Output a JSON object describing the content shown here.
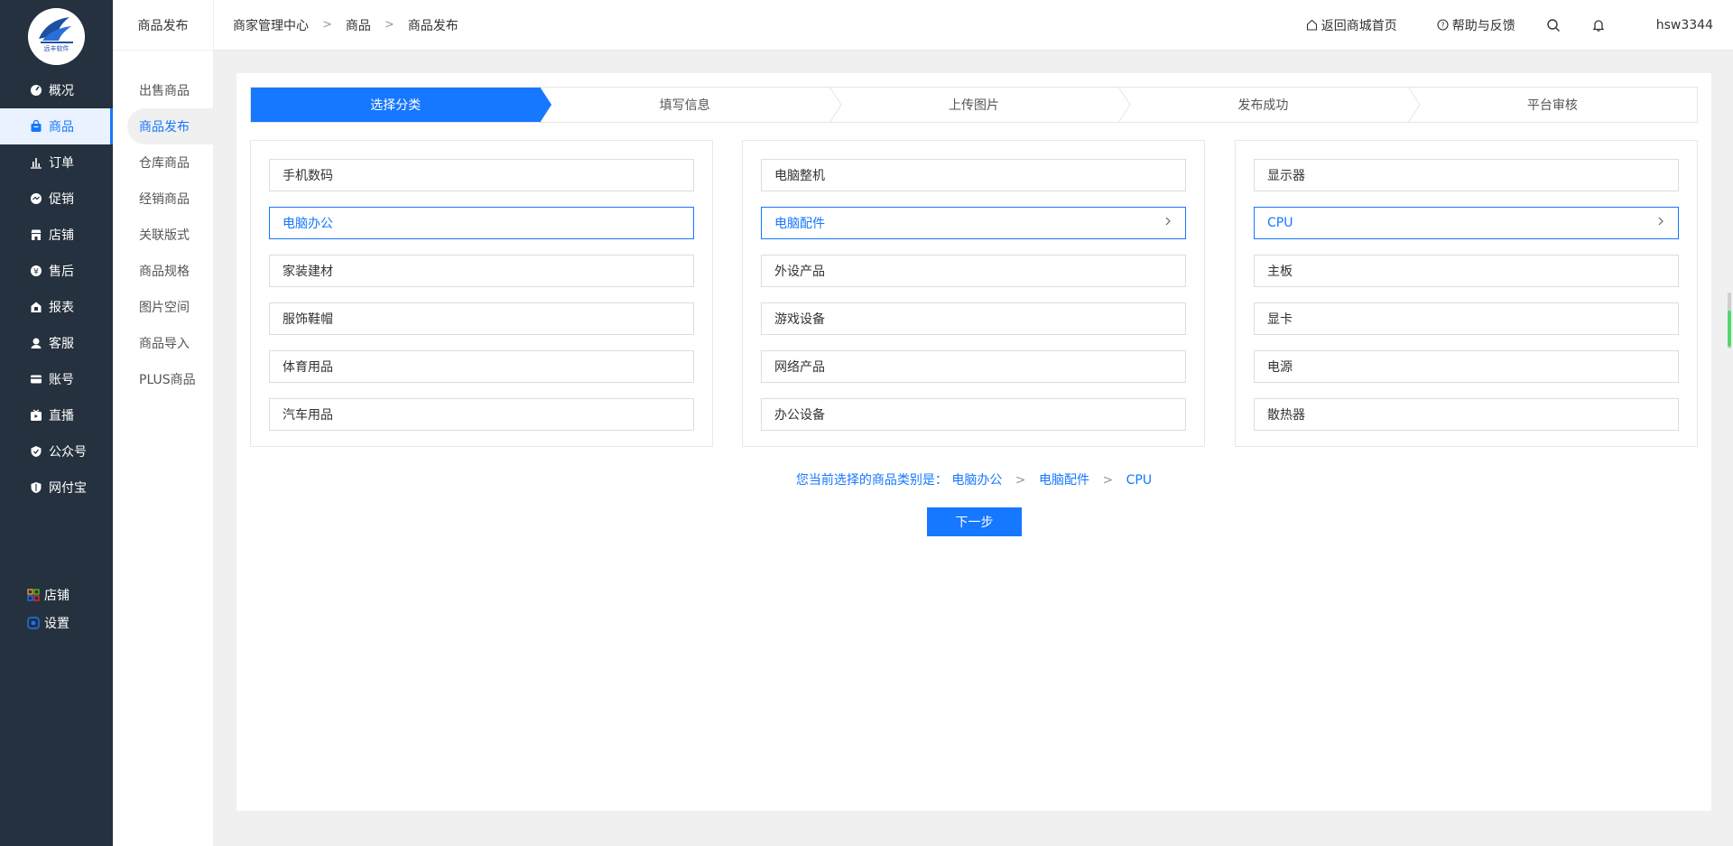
{
  "brand": {
    "logo_text": "远丰软件"
  },
  "sidebar": {
    "items": [
      {
        "label": "概况",
        "icon": "dashboard-icon"
      },
      {
        "label": "商品",
        "icon": "bag-icon",
        "active": true
      },
      {
        "label": "订单",
        "icon": "bar-chart-icon"
      },
      {
        "label": "促销",
        "icon": "promo-icon"
      },
      {
        "label": "店铺",
        "icon": "store-icon"
      },
      {
        "label": "售后",
        "icon": "aftersale-icon"
      },
      {
        "label": "报表",
        "icon": "report-icon"
      },
      {
        "label": "客服",
        "icon": "support-icon"
      },
      {
        "label": "账号",
        "icon": "account-icon"
      },
      {
        "label": "直播",
        "icon": "live-icon"
      },
      {
        "label": "公众号",
        "icon": "official-account-icon"
      },
      {
        "label": "网付宝",
        "icon": "shield-pay-icon"
      }
    ],
    "bottom": [
      {
        "label": "店铺",
        "icon": "grid-icon"
      },
      {
        "label": "设置",
        "icon": "settings-icon"
      }
    ]
  },
  "subnav": {
    "title": "商品发布",
    "items": [
      {
        "label": "出售商品"
      },
      {
        "label": "商品发布",
        "active": true
      },
      {
        "label": "仓库商品"
      },
      {
        "label": "经销商品"
      },
      {
        "label": "关联版式"
      },
      {
        "label": "商品规格"
      },
      {
        "label": "图片空间"
      },
      {
        "label": "商品导入"
      },
      {
        "label": "PLUS商品"
      }
    ]
  },
  "header": {
    "breadcrumb": [
      "商家管理中心",
      "商品",
      "商品发布"
    ],
    "home_link": "返回商城首页",
    "help_link": "帮助与反馈",
    "username": "hsw3344"
  },
  "steps": [
    {
      "label": "选择分类",
      "active": true
    },
    {
      "label": "填写信息"
    },
    {
      "label": "上传图片"
    },
    {
      "label": "发布成功"
    },
    {
      "label": "平台审核"
    }
  ],
  "columns": [
    {
      "options": [
        {
          "label": "手机数码"
        },
        {
          "label": "电脑办公",
          "selected": true
        },
        {
          "label": "家装建材"
        },
        {
          "label": "服饰鞋帽"
        },
        {
          "label": "体育用品"
        },
        {
          "label": "汽车用品"
        }
      ]
    },
    {
      "options": [
        {
          "label": "电脑整机"
        },
        {
          "label": "电脑配件",
          "selected": true
        },
        {
          "label": "外设产品"
        },
        {
          "label": "游戏设备"
        },
        {
          "label": "网络产品"
        },
        {
          "label": "办公设备"
        }
      ]
    },
    {
      "options": [
        {
          "label": "显示器"
        },
        {
          "label": "CPU",
          "selected": true
        },
        {
          "label": "主板"
        },
        {
          "label": "显卡"
        },
        {
          "label": "电源"
        },
        {
          "label": "散热器"
        }
      ]
    }
  ],
  "selection": {
    "prefix": "您当前选择的商品类别是：",
    "path": [
      "电脑办公",
      "电脑配件",
      "CPU"
    ]
  },
  "next_button": "下一步",
  "colors": {
    "accent": "#1677ff",
    "sidebar_bg": "#25313e"
  }
}
